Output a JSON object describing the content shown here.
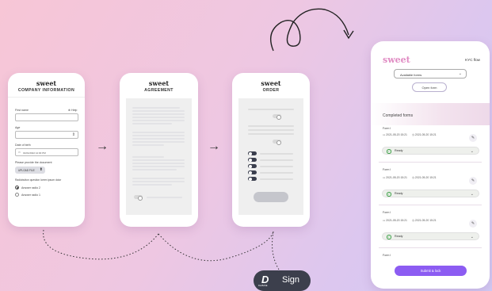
{
  "phone1": {
    "logo": "sweet",
    "title": "COMPANY INFORMATION",
    "first_name_label": "First name",
    "help_label": "Help",
    "age_label": "Age",
    "dob_label": "Date of birth",
    "dob_value": "01/01/2022 12:00 PM",
    "provide_doc_label": "Please provide the document",
    "upload_label": "UPLOAD FILE",
    "radio_question": "Radiobutton question lorem ipsum dolor",
    "radio_1": "Answer radio 2",
    "radio_2": "Answer radio 1"
  },
  "phone2": {
    "logo": "sweet",
    "title": "AGREEMENT"
  },
  "phone3": {
    "logo": "sweet",
    "title": "ORDER"
  },
  "kyc": {
    "logo": "sweet",
    "header_right": "KYC flow",
    "select_value": "Available forms",
    "open_form_label": "Open form",
    "completed_title": "Completed forms",
    "forms": [
      {
        "name": "Form I",
        "date_start": "2021-05-20 15:21",
        "date_end": "2021-05-20 15:21",
        "status": "Ready"
      },
      {
        "name": "Form I",
        "date_start": "2021-05-20 15:21",
        "date_end": "2021-05-20 15:21",
        "status": "Ready"
      },
      {
        "name": "Form I",
        "date_start": "2021-05-20 15:21",
        "date_end": "2021-05-20 15:21",
        "status": "Ready"
      },
      {
        "name": "Form I"
      }
    ],
    "submit_label": "Submit & lock"
  },
  "sign_badge": {
    "brand_small": "DocBASE",
    "label": "Sign"
  },
  "colors": {
    "accent_purple": "#8c5cf2",
    "logo_gradient_start": "#c06bd8",
    "logo_gradient_end": "#f3a0b6",
    "dark_toggle": "#3b3f4e",
    "badge_bg": "#3c3f4c",
    "ready_green": "#3fa24a"
  }
}
